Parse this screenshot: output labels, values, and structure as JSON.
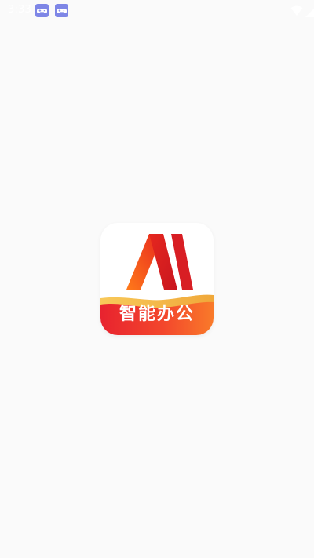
{
  "status_bar": {
    "time": "3:33",
    "icons": [
      "gamepad-icon",
      "gamepad-icon",
      "wifi-icon",
      "signal-icon",
      "battery-icon"
    ]
  },
  "splash": {
    "logo_letters": "AI",
    "logo_banner_text": "智能办公"
  },
  "colors": {
    "background": "#fafafa",
    "logo_red": "#e8283a",
    "logo_orange": "#f7642a",
    "banner_gold": "#f3c24a",
    "notif_icon": "#7e86e6"
  }
}
